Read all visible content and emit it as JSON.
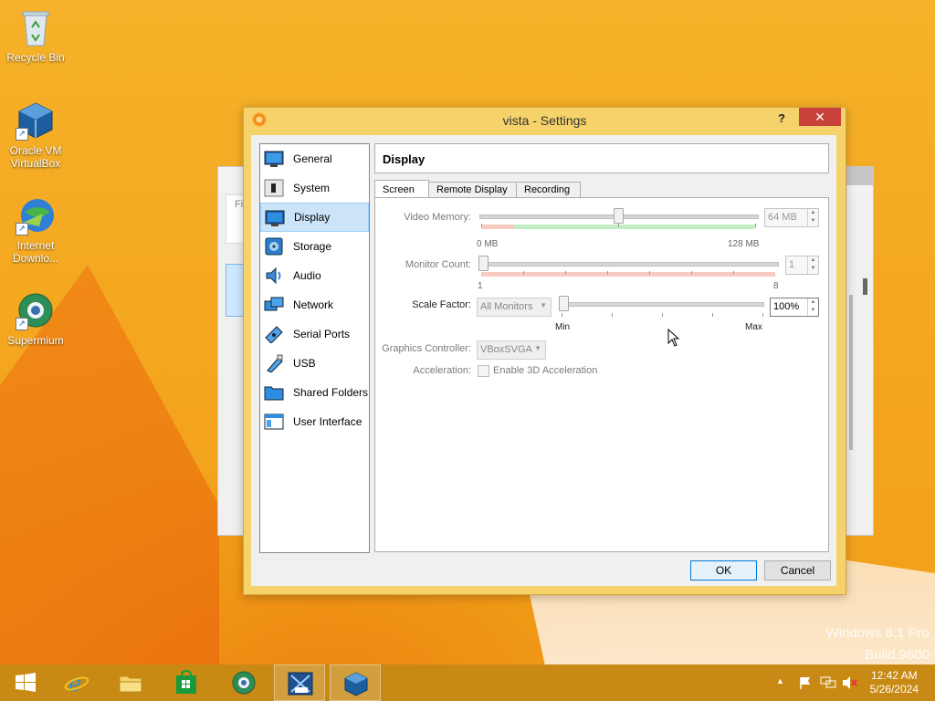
{
  "desktop": {
    "icons": [
      {
        "label": "Recycle Bin"
      },
      {
        "label": "Oracle VM VirtualBox"
      },
      {
        "label": "Internet Downlo..."
      },
      {
        "label": "Supermium"
      }
    ],
    "watermark": {
      "line1": "Windows 8.1 Pro",
      "line2": "Build 9600"
    }
  },
  "background_window": {
    "menu_text": "Fi"
  },
  "dialog": {
    "title": "vista - Settings",
    "help_label": "?",
    "close_label": "✕",
    "sidebar": {
      "items": [
        {
          "label": "General",
          "icon": "general-icon"
        },
        {
          "label": "System",
          "icon": "system-icon"
        },
        {
          "label": "Display",
          "icon": "display-icon"
        },
        {
          "label": "Storage",
          "icon": "storage-icon"
        },
        {
          "label": "Audio",
          "icon": "audio-icon"
        },
        {
          "label": "Network",
          "icon": "network-icon"
        },
        {
          "label": "Serial Ports",
          "icon": "serial-ports-icon"
        },
        {
          "label": "USB",
          "icon": "usb-icon"
        },
        {
          "label": "Shared Folders",
          "icon": "shared-folders-icon"
        },
        {
          "label": "User Interface",
          "icon": "user-interface-icon"
        }
      ],
      "selected": "Display"
    },
    "header": "Display",
    "tabs": [
      {
        "label": "Screen"
      },
      {
        "label": "Remote Display"
      },
      {
        "label": "Recording"
      }
    ],
    "active_tab": "Screen",
    "screen": {
      "video_memory": {
        "label": "Video Memory:",
        "value": "64 MB",
        "min": "0 MB",
        "max": "128 MB",
        "fraction": 0.5
      },
      "monitor_count": {
        "label": "Monitor Count:",
        "value": "1",
        "min": "1",
        "max": "8",
        "fraction": 0
      },
      "scale_factor": {
        "label": "Scale Factor:",
        "monitors": "All Monitors",
        "value": "100%",
        "min": "Min",
        "max": "Max",
        "fraction": 0
      },
      "graphics_controller": {
        "label": "Graphics Controller:",
        "value": "VBoxSVGA"
      },
      "acceleration": {
        "label": "Acceleration:",
        "checkbox_label": "Enable 3D Acceleration",
        "checked": false
      }
    },
    "buttons": {
      "ok": "OK",
      "cancel": "Cancel"
    }
  },
  "taskbar": {
    "apps": [
      "start",
      "internet-explorer",
      "file-explorer",
      "store",
      "supermium",
      "vista-vm",
      "virtualbox"
    ],
    "clock": {
      "time": "12:42 AM",
      "date": "5/26/2024"
    }
  },
  "colors": {
    "accent": "#0078d7",
    "close": "#c7413a",
    "selection": "#cce4f7",
    "taskbar": "#c88a14"
  }
}
